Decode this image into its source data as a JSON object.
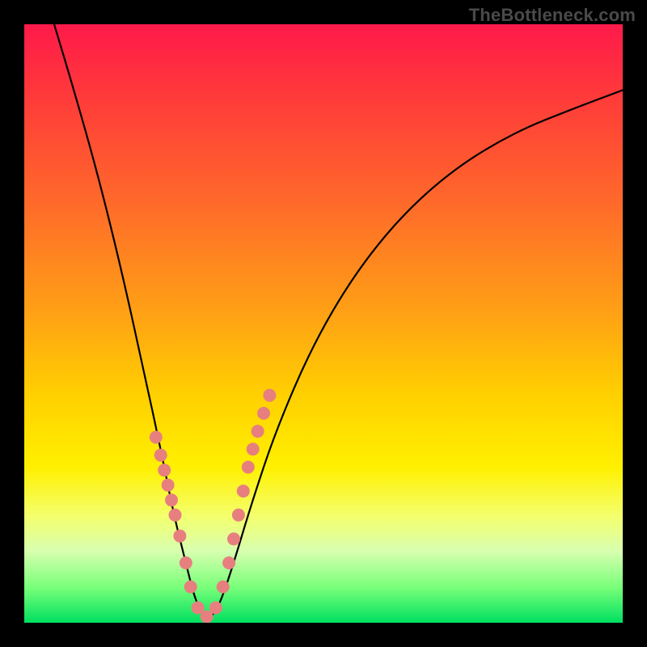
{
  "watermark": {
    "text": "TheBottleneck.com"
  },
  "chart_data": {
    "type": "line",
    "title": "",
    "xlabel": "",
    "ylabel": "",
    "xlim": [
      0,
      100
    ],
    "ylim": [
      0,
      100
    ],
    "grid": false,
    "legend": false,
    "series": [
      {
        "name": "bottleneck-curve",
        "x": [
          5,
          8,
          12,
          16,
          20,
          23,
          25,
          27,
          28.5,
          30,
          31.5,
          33,
          35,
          38,
          42,
          48,
          55,
          63,
          72,
          82,
          92,
          100
        ],
        "y": [
          100,
          90,
          76,
          60,
          42,
          28,
          18,
          10,
          4,
          1,
          1,
          4,
          10,
          20,
          32,
          46,
          58,
          68,
          76,
          82,
          86,
          89
        ]
      }
    ],
    "scatter_points": {
      "name": "sample-dots",
      "x": [
        22.0,
        22.8,
        23.4,
        24.0,
        24.6,
        25.2,
        26.0,
        27.0,
        27.8,
        29.0,
        30.5,
        32.0,
        33.2,
        34.2,
        35.0,
        35.8,
        36.6,
        37.4,
        38.2,
        39.0,
        40.0,
        41.0
      ],
      "y": [
        31,
        28,
        25.5,
        23,
        20.5,
        18,
        14.5,
        10,
        6,
        2.5,
        1,
        2.5,
        6,
        10,
        14,
        18,
        22,
        26,
        29,
        32,
        35,
        38
      ]
    }
  }
}
